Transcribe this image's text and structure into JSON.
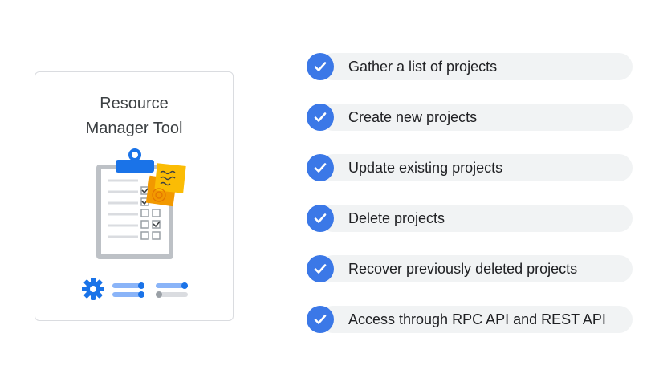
{
  "card": {
    "title_line1": "Resource",
    "title_line2": "Manager Tool",
    "illustration": "clipboard-checklist-icon",
    "controls": [
      "gear-icon",
      "toggle-icon"
    ]
  },
  "checklist": {
    "icon": "check-circle-icon",
    "accent": "#3b78e7",
    "items": [
      {
        "label": "Gather a list of projects"
      },
      {
        "label": "Create new projects"
      },
      {
        "label": "Update existing projects"
      },
      {
        "label": "Delete projects"
      },
      {
        "label": "Recover previously deleted projects"
      },
      {
        "label": "Access through RPC API and REST API"
      }
    ]
  }
}
